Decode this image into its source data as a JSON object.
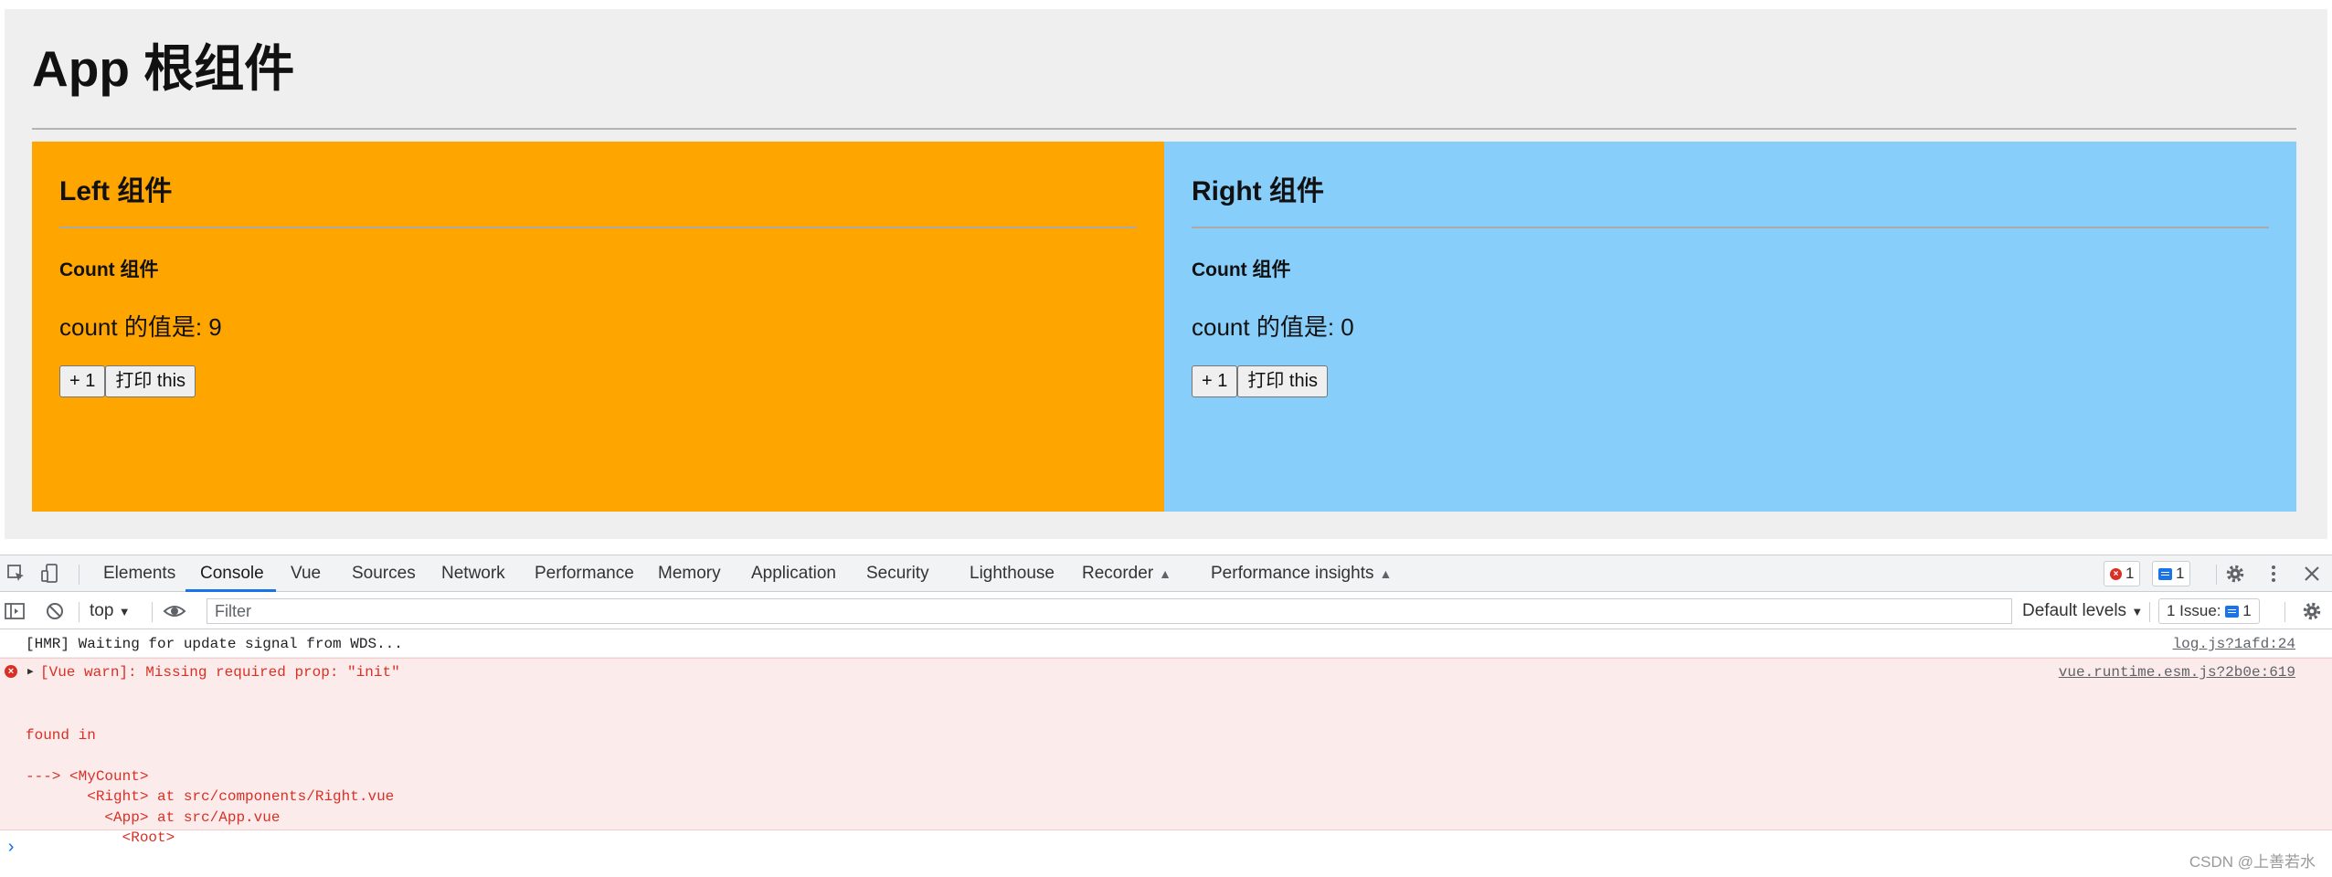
{
  "app": {
    "title": "App 根组件",
    "left": {
      "title": "Left 组件",
      "count_title": "Count 组件",
      "count_text": "count 的值是: 9",
      "inc_label": "+ 1",
      "print_label": "打印 this",
      "bg": "#ffa500"
    },
    "right": {
      "title": "Right 组件",
      "count_title": "Count 组件",
      "count_text": "count 的值是: 0",
      "inc_label": "+ 1",
      "print_label": "打印 this",
      "bg": "#87cefa"
    }
  },
  "devtools": {
    "tabs": [
      "Elements",
      "Console",
      "Vue",
      "Sources",
      "Network",
      "Performance",
      "Memory",
      "Application",
      "Security",
      "Lighthouse",
      "Recorder",
      "Performance insights"
    ],
    "active_tab": "Console",
    "error_count": "1",
    "message_count": "1",
    "toolbar": {
      "context": "top",
      "filter_placeholder": "Filter",
      "levels": "Default levels",
      "issues_label": "1 Issue:",
      "issues_count": "1"
    },
    "console": {
      "info_text": "[HMR] Waiting for update signal from WDS...",
      "info_source": "log.js?1afd:24",
      "error_head": "[Vue warn]: Missing required prop: \"init\"",
      "error_source": "vue.runtime.esm.js?2b0e:619",
      "trace_lines": [
        "",
        "found in",
        "",
        "---> <MyCount>",
        "       <Right> at src/components/Right.vue",
        "         <App> at src/App.vue",
        "           <Root>"
      ]
    },
    "accent": "#1a73e8",
    "error_color": "#d93025"
  },
  "watermark": "CSDN @上善若水"
}
